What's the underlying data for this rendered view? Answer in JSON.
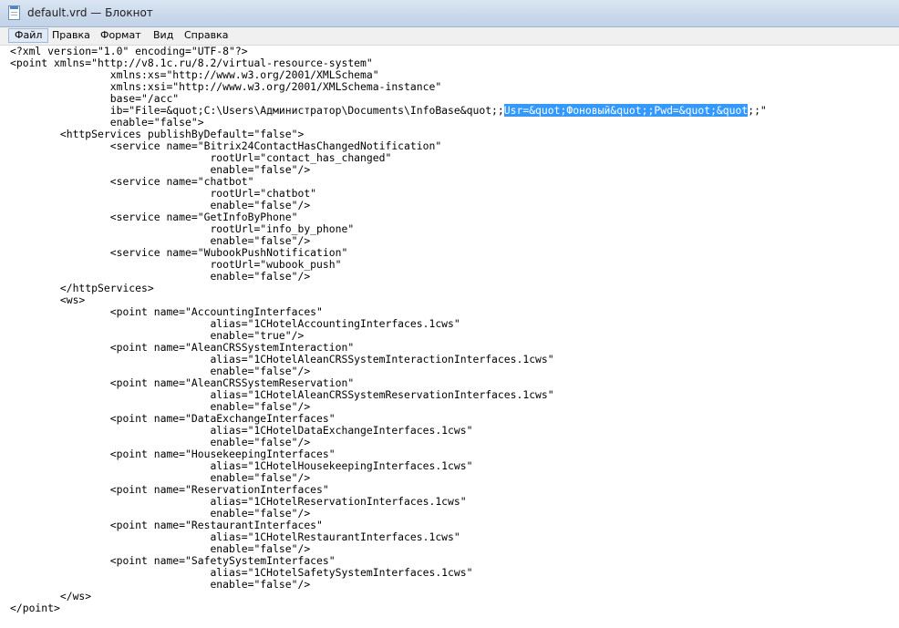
{
  "window": {
    "title": "default.vrd — Блокнот",
    "icon": "notepad-icon"
  },
  "menu": {
    "file": "Файл",
    "edit": "Правка",
    "format": "Формат",
    "view": "Вид",
    "help": "Справка"
  },
  "editor": {
    "lines": [
      "<?xml version=\"1.0\" encoding=\"UTF-8\"?>",
      "<point xmlns=\"http://v8.1c.ru/8.2/virtual-resource-system\"",
      "\t\txmlns:xs=\"http://www.w3.org/2001/XMLSchema\"",
      "\t\txmlns:xsi=\"http://www.w3.org/2001/XMLSchema-instance\"",
      "\t\tbase=\"/acc\"",
      "\t\tib=\"File=&quot;C:\\Users\\Администратор\\Documents\\InfoBase&quot;;",
      "\t\tenable=\"false\">",
      "\t<httpServices publishByDefault=\"false\">",
      "\t\t<service name=\"Bitrix24ContactHasChangedNotification\"",
      "\t\t\t\trootUrl=\"contact_has_changed\"",
      "\t\t\t\tenable=\"false\"/>",
      "\t\t<service name=\"chatbot\"",
      "\t\t\t\trootUrl=\"chatbot\"",
      "\t\t\t\tenable=\"false\"/>",
      "\t\t<service name=\"GetInfoByPhone\"",
      "\t\t\t\trootUrl=\"info_by_phone\"",
      "\t\t\t\tenable=\"false\"/>",
      "\t\t<service name=\"WubookPushNotification\"",
      "\t\t\t\trootUrl=\"wubook_push\"",
      "\t\t\t\tenable=\"false\"/>",
      "\t</httpServices>",
      "\t<ws>",
      "\t\t<point name=\"AccountingInterfaces\"",
      "\t\t\t\talias=\"1CHotelAccountingInterfaces.1cws\"",
      "\t\t\t\tenable=\"true\"/>",
      "\t\t<point name=\"AleanCRSSystemInteraction\"",
      "\t\t\t\talias=\"1CHotelAleanCRSSystemInteractionInterfaces.1cws\"",
      "\t\t\t\tenable=\"false\"/>",
      "\t\t<point name=\"AleanCRSSystemReservation\"",
      "\t\t\t\talias=\"1CHotelAleanCRSSystemReservationInterfaces.1cws\"",
      "\t\t\t\tenable=\"false\"/>",
      "\t\t<point name=\"DataExchangeInterfaces\"",
      "\t\t\t\talias=\"1CHotelDataExchangeInterfaces.1cws\"",
      "\t\t\t\tenable=\"false\"/>",
      "\t\t<point name=\"HousekeepingInterfaces\"",
      "\t\t\t\talias=\"1CHotelHousekeepingInterfaces.1cws\"",
      "\t\t\t\tenable=\"false\"/>",
      "\t\t<point name=\"ReservationInterfaces\"",
      "\t\t\t\talias=\"1CHotelReservationInterfaces.1cws\"",
      "\t\t\t\tenable=\"false\"/>",
      "\t\t<point name=\"RestaurantInterfaces\"",
      "\t\t\t\talias=\"1CHotelRestaurantInterfaces.1cws\"",
      "\t\t\t\tenable=\"false\"/>",
      "\t\t<point name=\"SafetySystemInterfaces\"",
      "\t\t\t\talias=\"1CHotelSafetySystemInterfaces.1cws\"",
      "\t\t\t\tenable=\"false\"/>",
      "\t</ws>",
      "</point>"
    ],
    "selected_text": "Usr=&quot;Фоновый&quot;;Pwd=&quot;&quot",
    "after_selection": ";;\""
  }
}
